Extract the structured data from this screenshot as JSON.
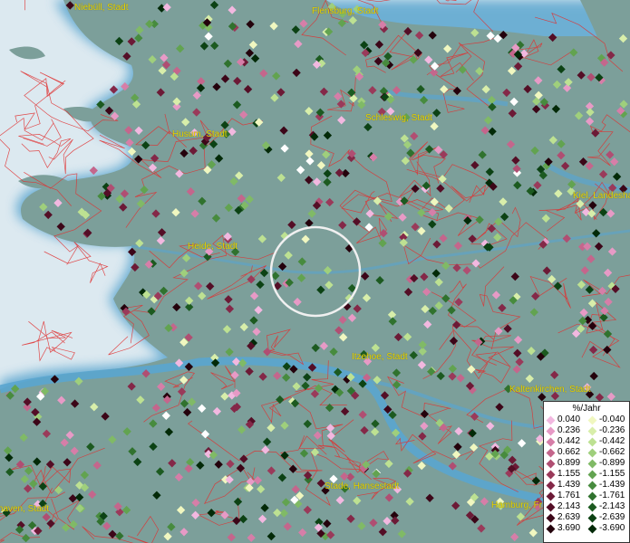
{
  "cities": [
    {
      "name": "Niebüll, Stadt"
    },
    {
      "name": "Flensburg, Stadt"
    },
    {
      "name": "Schleswig, Stadt"
    },
    {
      "name": "Husum, Stadt"
    },
    {
      "name": "Kiel, Landeshauptstadt"
    },
    {
      "name": "Heide, Stadt"
    },
    {
      "name": "Itzehoe, Stadt"
    },
    {
      "name": "Kaltenkirchen, Stadt"
    },
    {
      "name": "Stade, Hansestadt"
    },
    {
      "name": "Hamburg, Freie und Hansestadt"
    },
    {
      "name": "Cuxhaven, Stadt"
    }
  ],
  "legend": {
    "title": "%/Jahr",
    "positive": [
      {
        "label": "0.040",
        "color": "#f2b8e0"
      },
      {
        "label": "0.236",
        "color": "#e79ac6"
      },
      {
        "label": "0.442",
        "color": "#d67ea8"
      },
      {
        "label": "0.662",
        "color": "#c4668c"
      },
      {
        "label": "0.899",
        "color": "#b04e72"
      },
      {
        "label": "1.155",
        "color": "#9a3a5a"
      },
      {
        "label": "1.439",
        "color": "#842848"
      },
      {
        "label": "1.761",
        "color": "#6c1a36"
      },
      {
        "label": "2.143",
        "color": "#540e26"
      },
      {
        "label": "2.639",
        "color": "#3c0618"
      },
      {
        "label": "3.690",
        "color": "#24020c"
      }
    ],
    "negative": [
      {
        "label": "-0.040",
        "color": "#f0f7c0"
      },
      {
        "label": "-0.236",
        "color": "#d8eeaa"
      },
      {
        "label": "-0.442",
        "color": "#bde192"
      },
      {
        "label": "-0.662",
        "color": "#9fcf7c"
      },
      {
        "label": "-0.899",
        "color": "#80ba66"
      },
      {
        "label": "-1.155",
        "color": "#62a350"
      },
      {
        "label": "-1.439",
        "color": "#478b3e"
      },
      {
        "label": "-1.761",
        "color": "#30722e"
      },
      {
        "label": "-2.143",
        "color": "#1c5a20"
      },
      {
        "label": "-2.639",
        "color": "#0c4214"
      },
      {
        "label": "-3.690",
        "color": "#032a08"
      }
    ],
    "white_color": "#ffffff"
  },
  "colors": {
    "water": "#dce9f0",
    "land": "#7c9f9a",
    "shore_glow": "#5aa5cf",
    "borders": "#e03030",
    "city_label": "#e8d400",
    "focus_ring": "#f0f0f0"
  }
}
